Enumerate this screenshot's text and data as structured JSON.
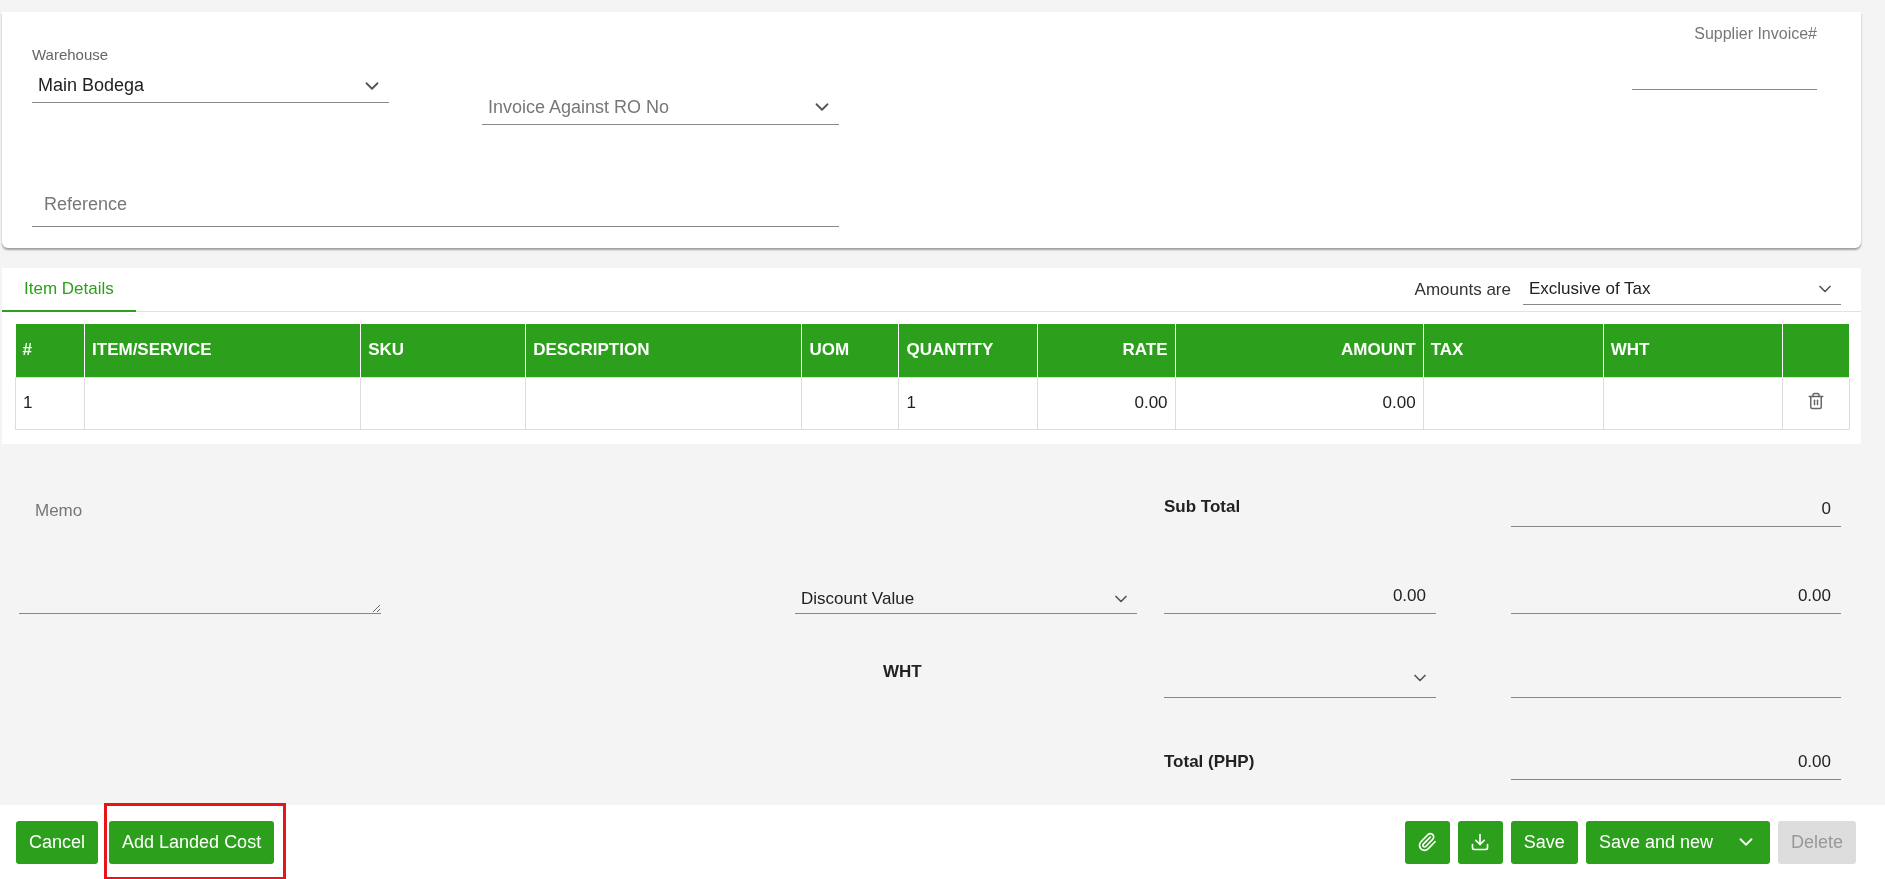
{
  "header_form": {
    "warehouse": {
      "label": "Warehouse",
      "value": "Main Bodega"
    },
    "invoice_against": {
      "placeholder": "Invoice Against RO No"
    },
    "reference": {
      "placeholder": "Reference"
    },
    "supplier_invoice": {
      "placeholder": "Supplier Invoice#"
    }
  },
  "tabs": [
    {
      "label": "Item Details",
      "selected": true
    }
  ],
  "amounts": {
    "label": "Amounts are",
    "value": "Exclusive of Tax"
  },
  "table": {
    "columns": [
      "#",
      "ITEM/SERVICE",
      "SKU",
      "DESCRIPTION",
      "UOM",
      "QUANTITY",
      "RATE",
      "AMOUNT",
      "TAX",
      "WHT"
    ],
    "rows": [
      {
        "cells": [
          "1",
          "",
          "",
          "",
          "",
          "1",
          "0.00",
          "0.00",
          "",
          ""
        ]
      }
    ]
  },
  "memo": {
    "placeholder": "Memo"
  },
  "totals": {
    "sub_total_label": "Sub Total",
    "sub_total": "0",
    "discount": {
      "placeholder": "Discount Value"
    },
    "discount_input": "0.00",
    "discount_amount": "0.00",
    "wht_label": "WHT",
    "total_label": "Total (PHP)",
    "total": "0.00"
  },
  "footer": {
    "left_buttons": [
      {
        "label": "Cancel",
        "highlighted": false
      },
      {
        "label": "Add Landed Cost",
        "highlighted": true
      }
    ],
    "save": "Save",
    "save_and_new": "Save and new",
    "delete": {
      "label": "Delete",
      "disabled": true
    }
  }
}
